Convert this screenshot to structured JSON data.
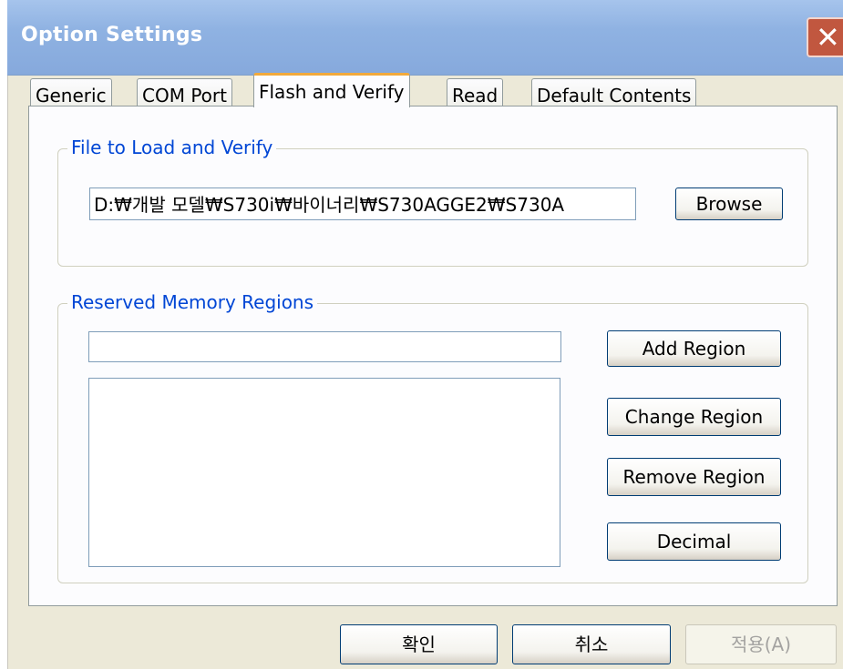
{
  "window": {
    "title": "Option Settings",
    "close_glyph": "✕"
  },
  "tabs": [
    {
      "label": "Generic"
    },
    {
      "label": "COM Port"
    },
    {
      "label": "Flash and Verify"
    },
    {
      "label": "Read"
    },
    {
      "label": "Default Contents"
    }
  ],
  "file_group": {
    "label": "File to Load and Verify",
    "path_value": "D:₩개발 모델₩S730i₩바이너리₩S730AGGE2₩S730A",
    "browse_label": "Browse"
  },
  "regions_group": {
    "label": "Reserved Memory Regions",
    "region_input_value": "",
    "add_label": "Add Region",
    "change_label": "Change Region",
    "remove_label": "Remove Region",
    "decimal_label": "Decimal"
  },
  "footer": {
    "ok_label": "확인",
    "cancel_label": "취소",
    "apply_label": "적용(A)"
  },
  "colors": {
    "titlebar": "#8fb2e2",
    "group_label": "#0046d5",
    "active_tab_accent": "#f1a93b"
  }
}
